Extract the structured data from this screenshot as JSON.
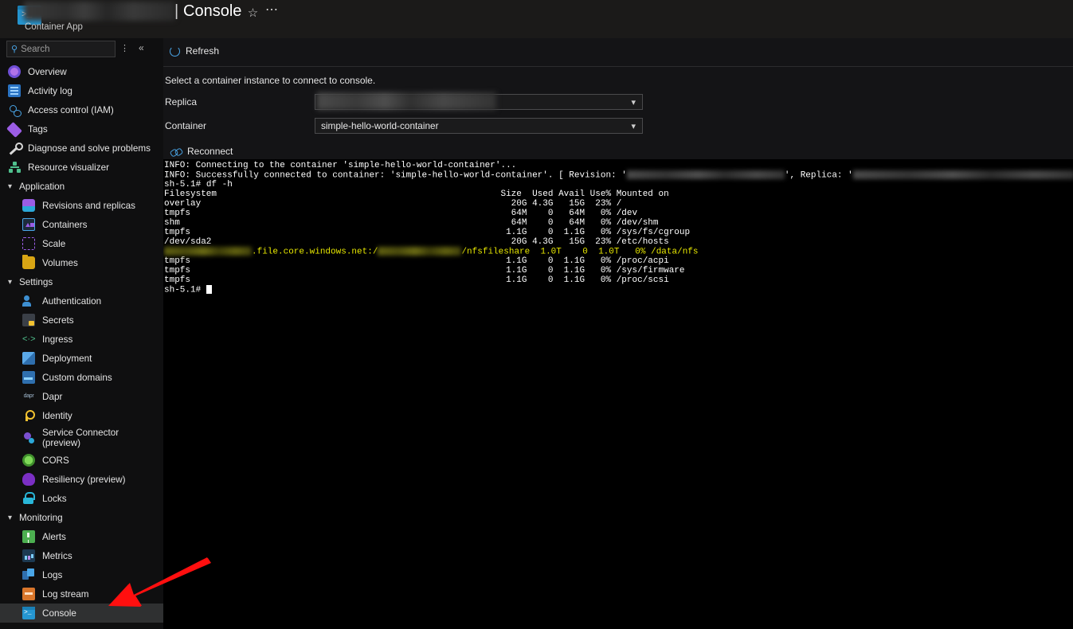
{
  "header": {
    "app_icon": "console-icon",
    "title_redacted": true,
    "separator": "|",
    "page_title": "Console",
    "subtitle": "Container App",
    "favorite_icon": "star-icon",
    "more_icon": "ellipsis-icon"
  },
  "sidebar": {
    "search": {
      "placeholder": "Search",
      "value": ""
    },
    "pin_icon": "pin-icon",
    "collapse_icon": "chevron-double-left-icon",
    "items": [
      {
        "label": "Overview",
        "icon": "overview-icon",
        "level": "top"
      },
      {
        "label": "Activity log",
        "icon": "activity-log-icon",
        "level": "top"
      },
      {
        "label": "Access control (IAM)",
        "icon": "access-control-icon",
        "level": "top"
      },
      {
        "label": "Tags",
        "icon": "tags-icon",
        "level": "top"
      },
      {
        "label": "Diagnose and solve problems",
        "icon": "diagnose-icon",
        "level": "top"
      },
      {
        "label": "Resource visualizer",
        "icon": "resource-visualizer-icon",
        "level": "top"
      },
      {
        "label": "Application",
        "icon": "chevron-down-icon",
        "level": "group"
      },
      {
        "label": "Revisions and replicas",
        "icon": "revisions-icon",
        "level": "sub"
      },
      {
        "label": "Containers",
        "icon": "containers-icon",
        "level": "sub"
      },
      {
        "label": "Scale",
        "icon": "scale-icon",
        "level": "sub"
      },
      {
        "label": "Volumes",
        "icon": "volumes-icon",
        "level": "sub"
      },
      {
        "label": "Settings",
        "icon": "chevron-down-icon",
        "level": "group"
      },
      {
        "label": "Authentication",
        "icon": "authentication-icon",
        "level": "sub"
      },
      {
        "label": "Secrets",
        "icon": "secrets-icon",
        "level": "sub"
      },
      {
        "label": "Ingress",
        "icon": "ingress-icon",
        "level": "sub"
      },
      {
        "label": "Deployment",
        "icon": "deployment-icon",
        "level": "sub"
      },
      {
        "label": "Custom domains",
        "icon": "custom-domains-icon",
        "level": "sub"
      },
      {
        "label": "Dapr",
        "icon": "dapr-icon",
        "level": "sub"
      },
      {
        "label": "Identity",
        "icon": "identity-icon",
        "level": "sub"
      },
      {
        "label": "Service Connector (preview)",
        "icon": "service-connector-icon",
        "level": "sub"
      },
      {
        "label": "CORS",
        "icon": "cors-icon",
        "level": "sub"
      },
      {
        "label": "Resiliency (preview)",
        "icon": "resiliency-icon",
        "level": "sub"
      },
      {
        "label": "Locks",
        "icon": "locks-icon",
        "level": "sub"
      },
      {
        "label": "Monitoring",
        "icon": "chevron-down-icon",
        "level": "group"
      },
      {
        "label": "Alerts",
        "icon": "alerts-icon",
        "level": "sub"
      },
      {
        "label": "Metrics",
        "icon": "metrics-icon",
        "level": "sub"
      },
      {
        "label": "Logs",
        "icon": "logs-icon",
        "level": "sub"
      },
      {
        "label": "Log stream",
        "icon": "log-stream-icon",
        "level": "sub"
      },
      {
        "label": "Console",
        "icon": "console-icon",
        "level": "sub",
        "selected": true
      }
    ]
  },
  "main": {
    "refresh_label": "Refresh",
    "instruction": "Select a container instance to connect to console.",
    "replica_label": "Replica",
    "replica_value": "",
    "container_label": "Container",
    "container_value": "simple-hello-world-container",
    "reconnect_label": "Reconnect"
  },
  "terminal": {
    "line_info_connecting": "INFO: Connecting to the container 'simple-hello-world-container'...",
    "line_info_connected_pre": "INFO: Successfully connected to container: 'simple-hello-world-container'. [ Revision: '",
    "line_info_connected_mid": "', Replica: '",
    "line_info_connected_post": "'].",
    "prompt": "sh-5.1# ",
    "command": "df -h",
    "header_cols": "Filesystem                                                      Size  Used Avail Use% Mounted on",
    "rows": [
      {
        "fs": "overlay",
        "size": "20G",
        "used": "4.3G",
        "avail": "15G",
        "usep": "23%",
        "mount": "/"
      },
      {
        "fs": "tmpfs",
        "size": "64M",
        "used": "0",
        "avail": "64M",
        "usep": "0%",
        "mount": "/dev"
      },
      {
        "fs": "shm",
        "size": "64M",
        "used": "0",
        "avail": "64M",
        "usep": "0%",
        "mount": "/dev/shm"
      },
      {
        "fs": "tmpfs",
        "size": "1.1G",
        "used": "0",
        "avail": "1.1G",
        "usep": "0%",
        "mount": "/sys/fs/cgroup"
      },
      {
        "fs": "/dev/sda2",
        "size": "20G",
        "used": "4.3G",
        "avail": "15G",
        "usep": "23%",
        "mount": "/etc/hosts"
      },
      {
        "fs": "NFS_REDACTED",
        "nfs_mid": ".file.core.windows.net:/",
        "nfs_tail": "/nfsfileshare",
        "size": "1.0T",
        "used": "0",
        "avail": "1.0T",
        "usep": "0%",
        "mount": "/data/nfs",
        "highlight": true
      },
      {
        "fs": "tmpfs",
        "size": "1.1G",
        "used": "0",
        "avail": "1.1G",
        "usep": "0%",
        "mount": "/proc/acpi"
      },
      {
        "fs": "tmpfs",
        "size": "1.1G",
        "used": "0",
        "avail": "1.1G",
        "usep": "0%",
        "mount": "/sys/firmware"
      },
      {
        "fs": "tmpfs",
        "size": "1.1G",
        "used": "0",
        "avail": "1.1G",
        "usep": "0%",
        "mount": "/proc/scsi"
      }
    ],
    "final_prompt": "sh-5.1# "
  },
  "annotation": {
    "arrow_color": "#ff0f0f",
    "arrow_icon": "red-arrow-annotation"
  }
}
